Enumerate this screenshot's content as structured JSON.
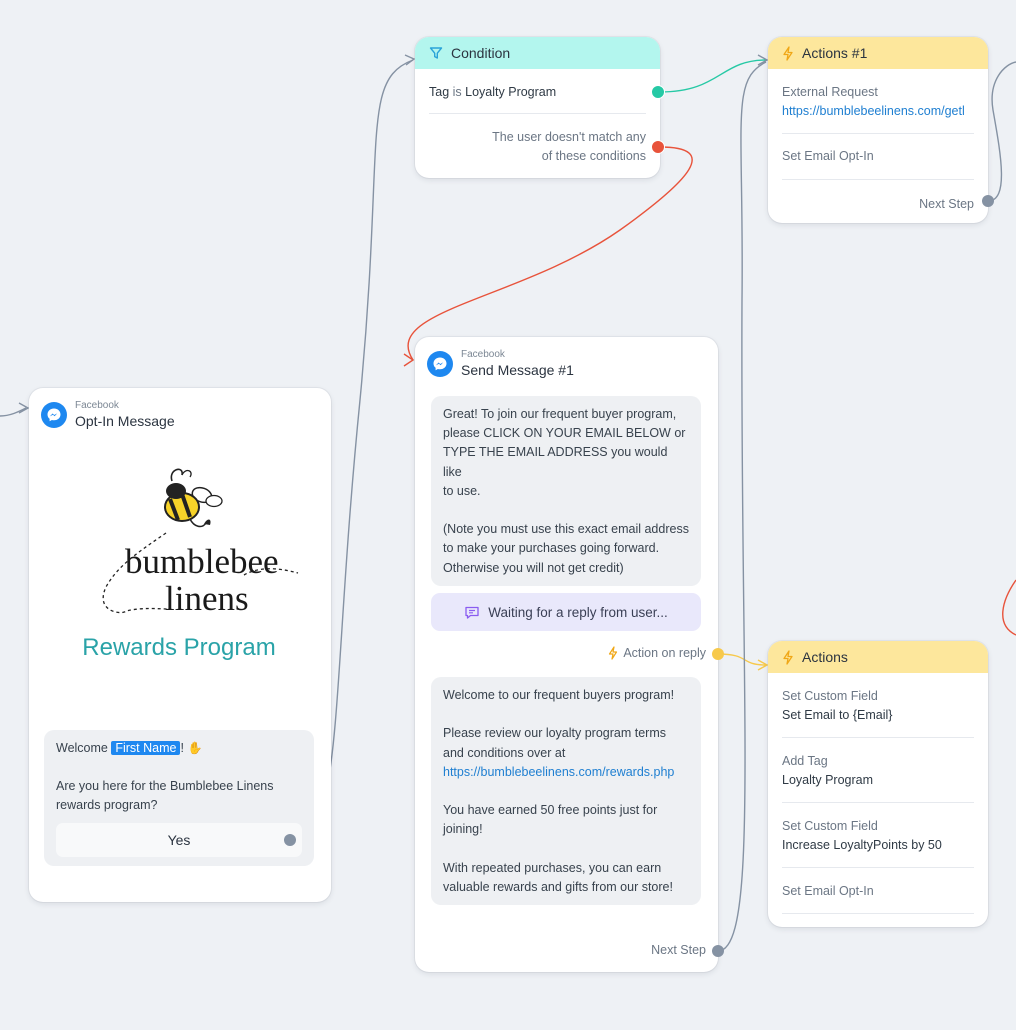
{
  "condition": {
    "title": "Condition",
    "rule_field": "Tag",
    "rule_op": "is",
    "rule_value": "Loyalty Program",
    "no_match_line1": "The user doesn't match any",
    "no_match_line2": "of these conditions"
  },
  "actions1": {
    "title": "Actions #1",
    "items": [
      {
        "label": "External Request",
        "value": "https://bumblebeelinens.com/getl"
      },
      {
        "label": "Set Email Opt-In"
      }
    ],
    "next_step": "Next Step"
  },
  "optin": {
    "platform": "Facebook",
    "title": "Opt-In Message",
    "logo_word1": "bumblebee",
    "logo_word2": "linens",
    "rewards_text": "Rewards Program",
    "welcome_prefix": "Welcome",
    "first_name_tag": "First Name",
    "welcome_suffix": "!",
    "question_line1": "Are you here for the Bumblebee Linens",
    "question_line2": "rewards program?",
    "yes_button": "Yes"
  },
  "send_message": {
    "platform": "Facebook",
    "title": "Send Message #1",
    "bubble1": [
      "Great! To join our frequent buyer program,",
      "please CLICK ON YOUR EMAIL BELOW or",
      "TYPE THE EMAIL ADDRESS you would like",
      "to use.",
      "",
      "(Note you must use this exact email address",
      "to make your purchases going forward.",
      "Otherwise you will not get credit)"
    ],
    "waiting": "Waiting for a reply from user...",
    "action_on_reply": "Action on reply",
    "bubble2": [
      "Welcome to our frequent buyers program!",
      "",
      "Please review our loyalty program terms",
      "and conditions over at",
      "https://bumblebeelinens.com/rewards.php",
      "",
      "You have earned 50 free points just for",
      "joining!",
      "",
      "With repeated purchases, you can earn",
      "valuable rewards and gifts from our store!"
    ],
    "next_step": "Next Step"
  },
  "actions2": {
    "title": "Actions",
    "items": [
      {
        "label": "Set Custom Field",
        "value": "Set Email to {Email}"
      },
      {
        "label": "Add Tag",
        "value": "Loyalty Program"
      },
      {
        "label": "Set Custom Field",
        "value": "Increase LoyaltyPoints by 50"
      },
      {
        "label": "Set Email Opt-In"
      }
    ]
  },
  "colors": {
    "canvas": "#eef1f5",
    "condition_header": "#b3f6ee",
    "actions_header": "#fde79c",
    "match_connector": "#26c9a5",
    "nomatch_connector": "#e8533b",
    "reply_connector": "#f7c94b",
    "gray_connector": "#8592a3",
    "messenger_blue": "#1e88f0",
    "rewards_teal": "#2aa3a8"
  }
}
